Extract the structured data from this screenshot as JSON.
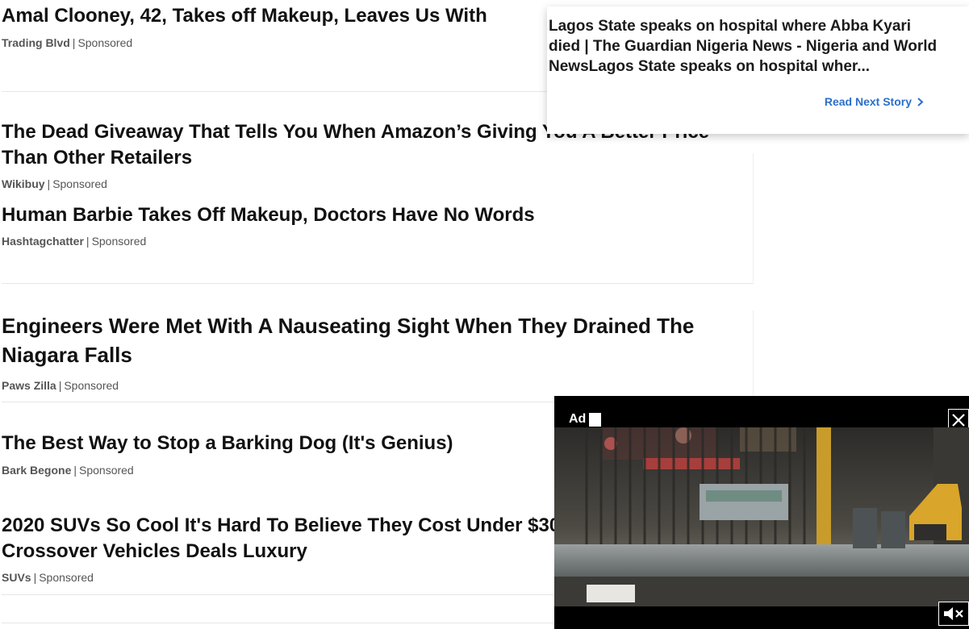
{
  "articles": [
    {
      "title": "Amal Clooney, 42, Takes off Makeup, Leaves Us With",
      "source": "Trading Blvd",
      "label": "Sponsored"
    },
    {
      "title": "The Dead Giveaway That Tells You When Amazon’s Giving You A Better Price Than Other Retailers",
      "source": "Wikibuy",
      "label": "Sponsored"
    },
    {
      "title": "Human Barbie Takes Off Makeup, Doctors Have No Words",
      "source": "Hashtagchatter",
      "label": "Sponsored"
    },
    {
      "title": "Engineers Were Met With A Nauseating Sight When They Drained The Niagara Falls",
      "source": "Paws Zilla",
      "label": "Sponsored"
    },
    {
      "title": "The Best Way to Stop a Barking Dog (It's Genius)",
      "source": "Bark Begone",
      "label": "Sponsored"
    },
    {
      "title": "2020 SUVs So Cool It's Hard To Believe They Cost Under $30 Crossover Vehicles Deals Luxury",
      "source": "SUVs",
      "label": "Sponsored"
    }
  ],
  "meta_separator": "|",
  "next_story": {
    "title": "Lagos State speaks on hospital where Abba Kyari died | The Guardian Nigeria News - Nigeria and World NewsLagos State speaks on hospital wher...",
    "cta": "Read Next Story"
  },
  "video_ad": {
    "label": "Ad",
    "close_icon": "close-icon",
    "mute_icon": "speaker-muted-icon"
  },
  "colors": {
    "link_blue": "#2a6fc9",
    "text": "#111111",
    "meta": "#555555"
  }
}
